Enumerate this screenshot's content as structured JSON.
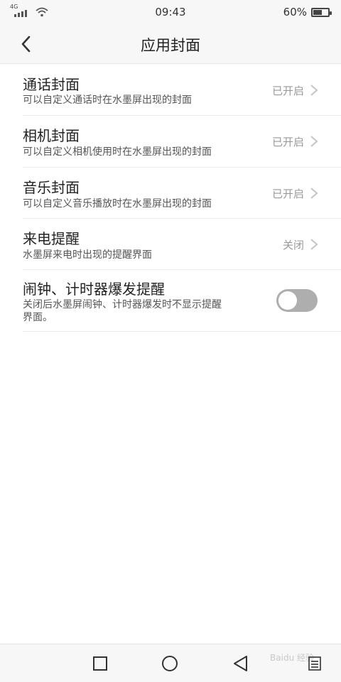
{
  "status_bar": {
    "network": "4G",
    "time": "09:43",
    "battery_percent": "60%",
    "battery_level": 0.6
  },
  "header": {
    "title": "应用封面"
  },
  "settings": [
    {
      "title": "通话封面",
      "subtitle": "可以自定义通话时在水墨屏出现的封面",
      "value": "已开启"
    },
    {
      "title": "相机封面",
      "subtitle": "可以自定义相机使用时在水墨屏出现的封面",
      "value": "已开启"
    },
    {
      "title": "音乐封面",
      "subtitle": "可以自定义音乐播放时在水墨屏出现的封面",
      "value": "已开启"
    },
    {
      "title": "来电提醒",
      "subtitle": "水墨屏来电时出现的提醒界面",
      "value": "关闭"
    },
    {
      "title": "闹钟、计时器爆发提醒",
      "subtitle_line1": "关闭后水墨屏闹钟、计时器爆发时不显示提醒",
      "subtitle_line2": "界面。",
      "toggle_on": false
    }
  ],
  "nav": {
    "icons": [
      "recent-apps-icon",
      "home-icon",
      "back-icon",
      "menu-icon"
    ]
  },
  "watermark": "Baidu 经验"
}
